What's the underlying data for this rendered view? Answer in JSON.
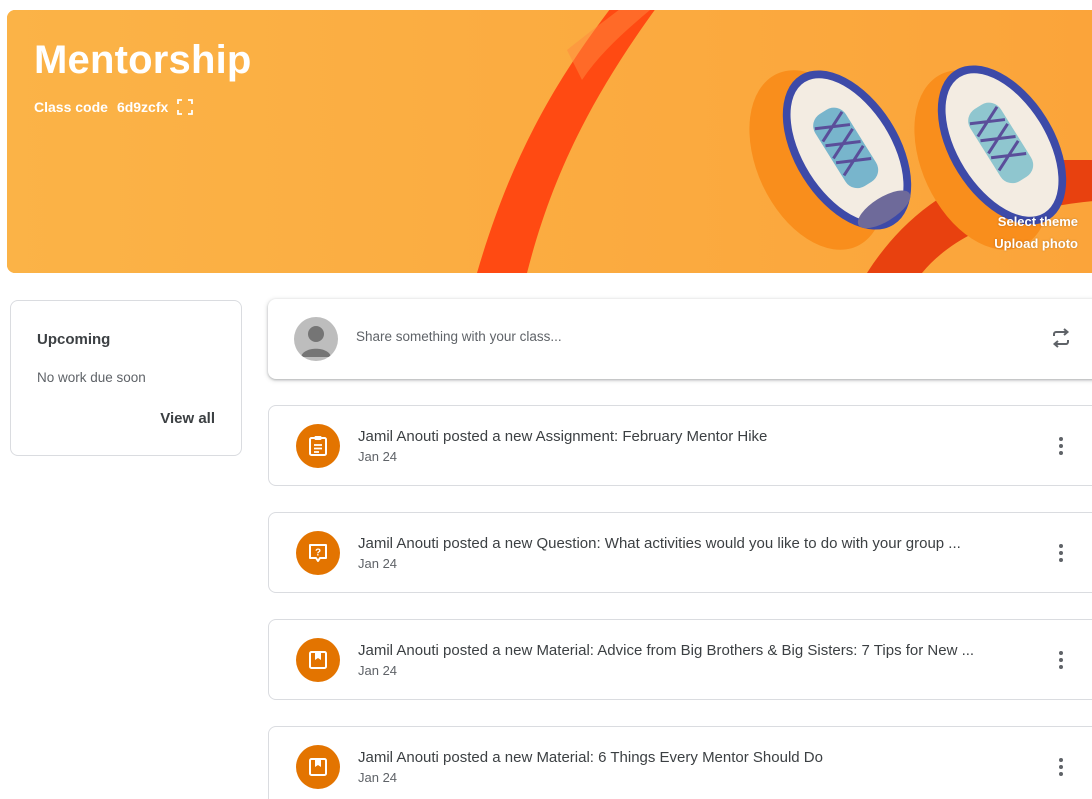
{
  "banner": {
    "title": "Mentorship",
    "class_code_label": "Class code",
    "class_code_value": "6d9zcfx",
    "select_theme": "Select theme",
    "upload_photo": "Upload photo",
    "colors": {
      "background": "#fbb347",
      "stripe": "#ff4a12",
      "accent": "#f98e1c"
    }
  },
  "upcoming": {
    "title": "Upcoming",
    "empty_text": "No work due soon",
    "view_all": "View all"
  },
  "share": {
    "placeholder": "Share something with your class..."
  },
  "posts": [
    {
      "icon": "assignment-icon",
      "title": "Jamil Anouti posted a new Assignment: February Mentor Hike",
      "date": "Jan 24"
    },
    {
      "icon": "question-icon",
      "title": "Jamil Anouti posted a new Question: What activities would you like to do with your group ...",
      "date": "Jan 24"
    },
    {
      "icon": "material-icon",
      "title": "Jamil Anouti posted a new Material: Advice from Big Brothers & Big Sisters: 7 Tips for New ...",
      "date": "Jan 24"
    },
    {
      "icon": "material-icon",
      "title": "Jamil Anouti posted a new Material: 6 Things Every Mentor Should Do",
      "date": "Jan 24"
    }
  ],
  "colors": {
    "post_icon_bg": "#e37400"
  }
}
